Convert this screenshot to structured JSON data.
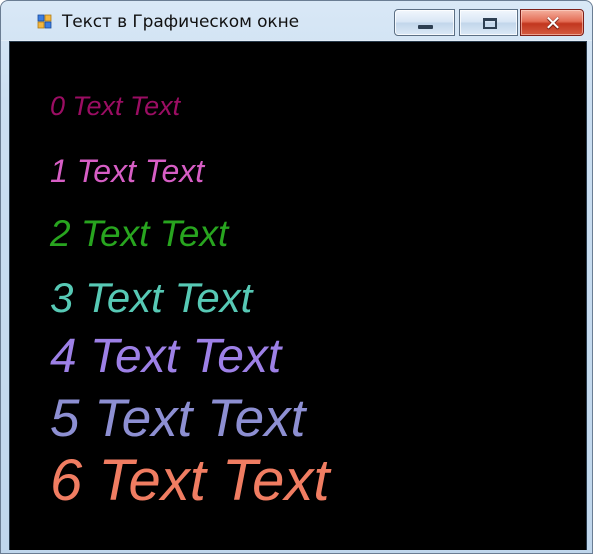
{
  "window": {
    "title": "Текст в Графическом окне",
    "buttons": {
      "minimize_symbol": "—",
      "maximize_symbol": "□",
      "close_symbol": "✕"
    }
  },
  "canvas": {
    "background": "#000000",
    "lines": [
      {
        "text": "0 Text Text",
        "color": "#9b0d63"
      },
      {
        "text": "1 Text Text",
        "color": "#d75ec5"
      },
      {
        "text": "2 Text Text",
        "color": "#28a51f"
      },
      {
        "text": "3 Text Text",
        "color": "#57c9b5"
      },
      {
        "text": "4 Text Text",
        "color": "#9d80e6"
      },
      {
        "text": "5 Text Text",
        "color": "#8d8fd2"
      },
      {
        "text": "6 Text Text",
        "color": "#f07d62"
      }
    ]
  },
  "icons": {
    "app": "app-window-icon",
    "minimize": "minimize-icon",
    "maximize": "maximize-icon",
    "close": "close-icon"
  }
}
